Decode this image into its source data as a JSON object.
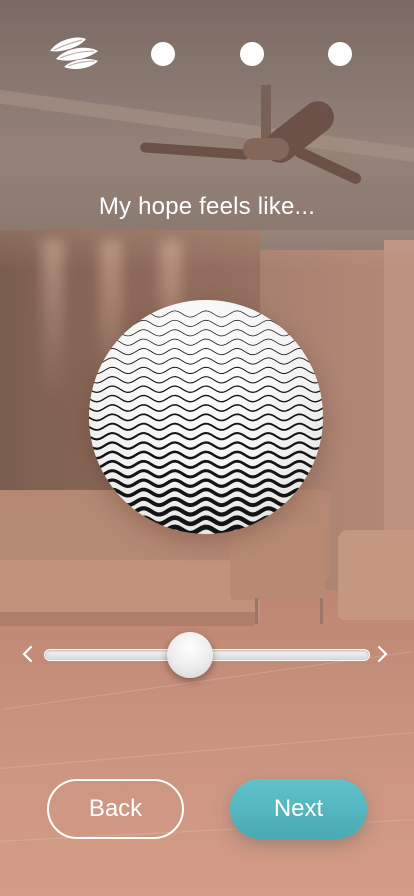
{
  "header": {
    "logo_icon": "seed-leaves-icon",
    "steps": [
      {
        "name": "step-dot-1"
      },
      {
        "name": "step-dot-2"
      },
      {
        "name": "step-dot-3"
      }
    ]
  },
  "prompt": {
    "text": "My hope feels like..."
  },
  "texture": {
    "icon": "wave-pattern",
    "pattern": "wavy-lines",
    "colors": [
      "#ffffff",
      "#111111"
    ]
  },
  "slider": {
    "left_icon": "chevron-left-icon",
    "right_icon": "chevron-right-icon",
    "value_fraction": 0.45
  },
  "buttons": {
    "back_label": "Back",
    "next_label": "Next"
  },
  "colors": {
    "accent": "#52b5bd",
    "text": "#ffffff"
  }
}
